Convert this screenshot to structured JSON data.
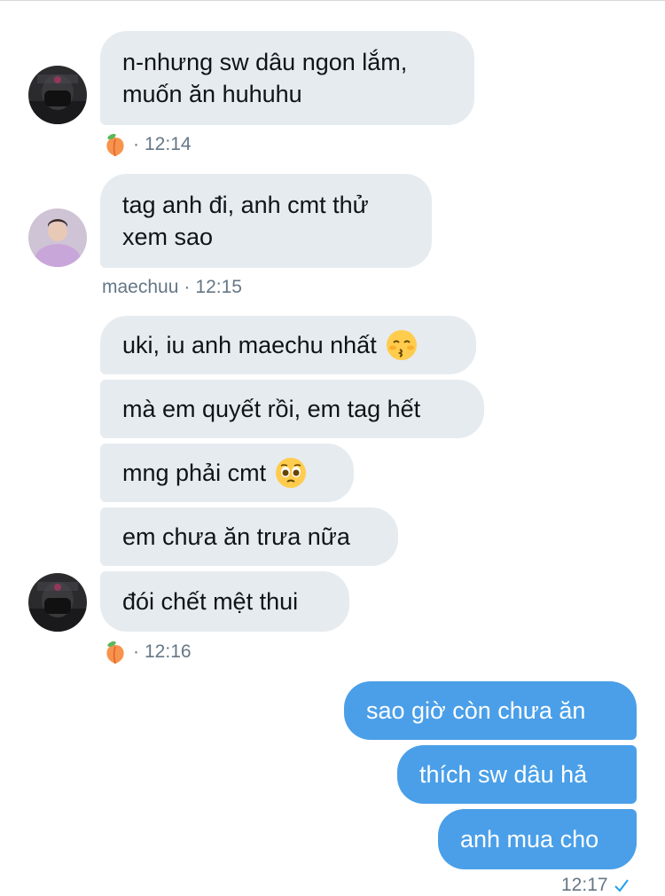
{
  "conversation": {
    "groups": [
      {
        "messages": [
          "n-nhưng sw dâu ngon lắm,\nmuốn ăn huhuhu"
        ],
        "sender": "",
        "time": "12:14"
      },
      {
        "messages": [
          "tag anh đi, anh cmt thử\nxem sao"
        ],
        "sender": "maechuu",
        "time": "12:15"
      },
      {
        "messages": [
          "uki, iu anh maechu nhất",
          "mà em quyết rồi, em tag hết",
          "mng phải cmt",
          "em chưa ăn trưa nữa",
          "đói chết mệt thui"
        ],
        "sender": "",
        "time": "12:16"
      }
    ],
    "outgoing": {
      "messages": [
        "sao giờ còn chưa ăn",
        "thích sw dâu hả",
        "anh mua cho"
      ],
      "time": "12:17"
    },
    "separator": "·",
    "icons": {
      "sender_badge": "peach-emoji-icon",
      "read_receipt": "checkmark-icon",
      "kiss_emoji": "kissing-face-emoji-icon",
      "pleading_emoji": "pleading-face-emoji-icon"
    },
    "colors": {
      "incoming_bubble": "#e6ebf0",
      "outgoing_bubble": "#4a9fe8",
      "meta_text": "#657786",
      "accent": "#1da1f2"
    }
  }
}
